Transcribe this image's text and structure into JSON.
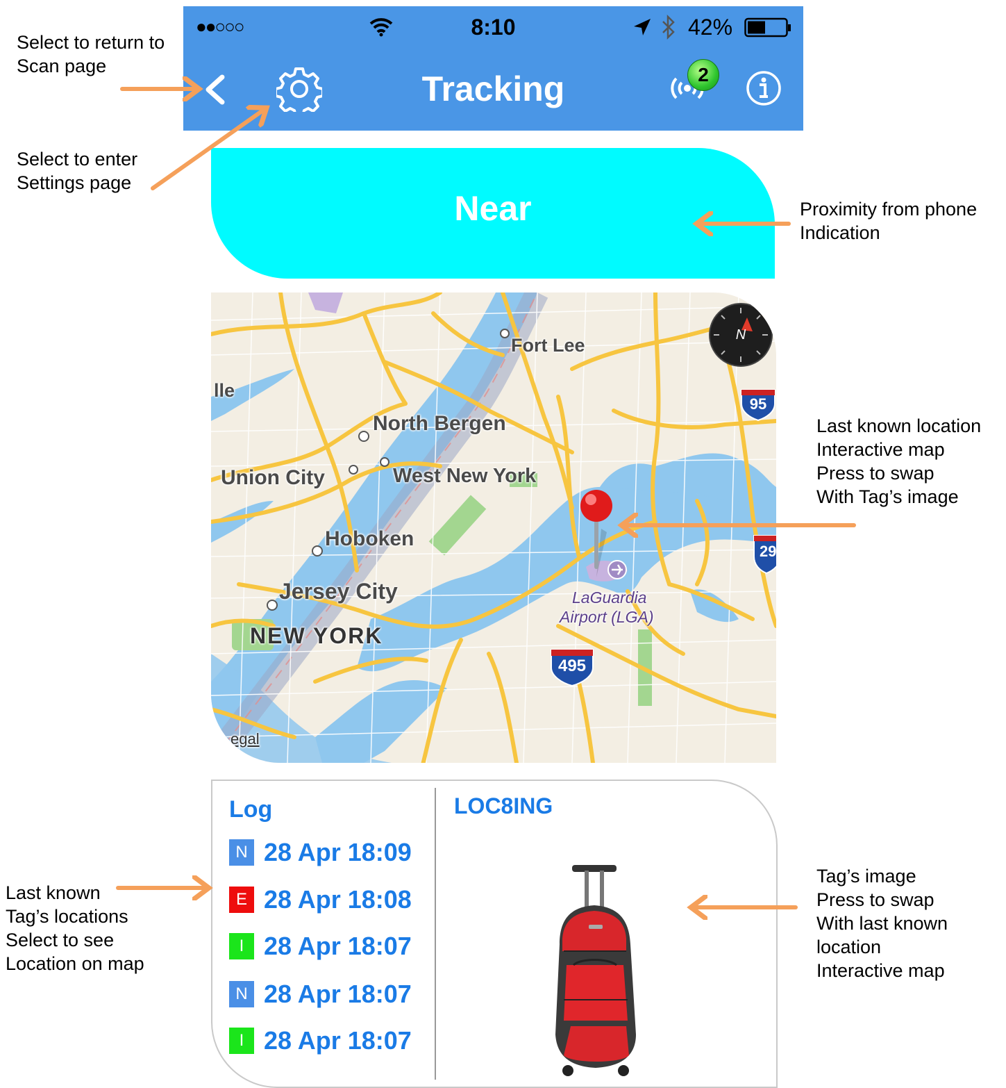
{
  "annotations": {
    "back": [
      "Select to return to",
      "Scan page"
    ],
    "settings": [
      "Select to enter",
      "Settings page"
    ],
    "proximity": [
      "Proximity from phone",
      "Indication"
    ],
    "map": [
      "Last known location",
      "Interactive map",
      "Press to swap",
      "With Tag’s image"
    ],
    "log": [
      "Last known",
      "Tag’s locations",
      "Select to see",
      "Location on map"
    ],
    "tag_image": [
      "Tag’s image",
      "Press to swap",
      "With last known",
      "location",
      "Interactive map"
    ],
    "arrow_color": "#f5a05a"
  },
  "status_bar": {
    "signal": "●●○○○",
    "time": "8:10",
    "battery": "42%"
  },
  "nav": {
    "title": "Tracking",
    "tag_count": "2",
    "header_color": "#4a96e6"
  },
  "proximity": {
    "label": "Near",
    "color": "#00fbff"
  },
  "map": {
    "labels": {
      "fort_lee": "Fort Lee",
      "lle": "lle",
      "north_bergen": "North Bergen",
      "union_city": "Union City",
      "west_new_york": "West New York",
      "hoboken": "Hoboken",
      "jersey_city": "Jersey City",
      "new_york": "NEW YORK",
      "laguardia": "LaGuardia",
      "airport": "Airport (LGA)",
      "i95": "95",
      "i495": "495",
      "i29": "29",
      "legal": "egal",
      "compass": "N"
    }
  },
  "log": {
    "heading": "Log",
    "entries": [
      {
        "badge": "N",
        "badge_color": "#4a8fe6",
        "time": "28 Apr 18:09"
      },
      {
        "badge": "E",
        "badge_color": "#ee0d0d",
        "time": "28 Apr 18:08"
      },
      {
        "badge": "I",
        "badge_color": "#1be51b",
        "time": "28 Apr 18:07"
      },
      {
        "badge": "N",
        "badge_color": "#4a8fe6",
        "time": "28 Apr 18:07"
      },
      {
        "badge": "I",
        "badge_color": "#1be51b",
        "time": "28 Apr 18:07"
      }
    ]
  },
  "tag": {
    "name": "LOC8ING"
  }
}
